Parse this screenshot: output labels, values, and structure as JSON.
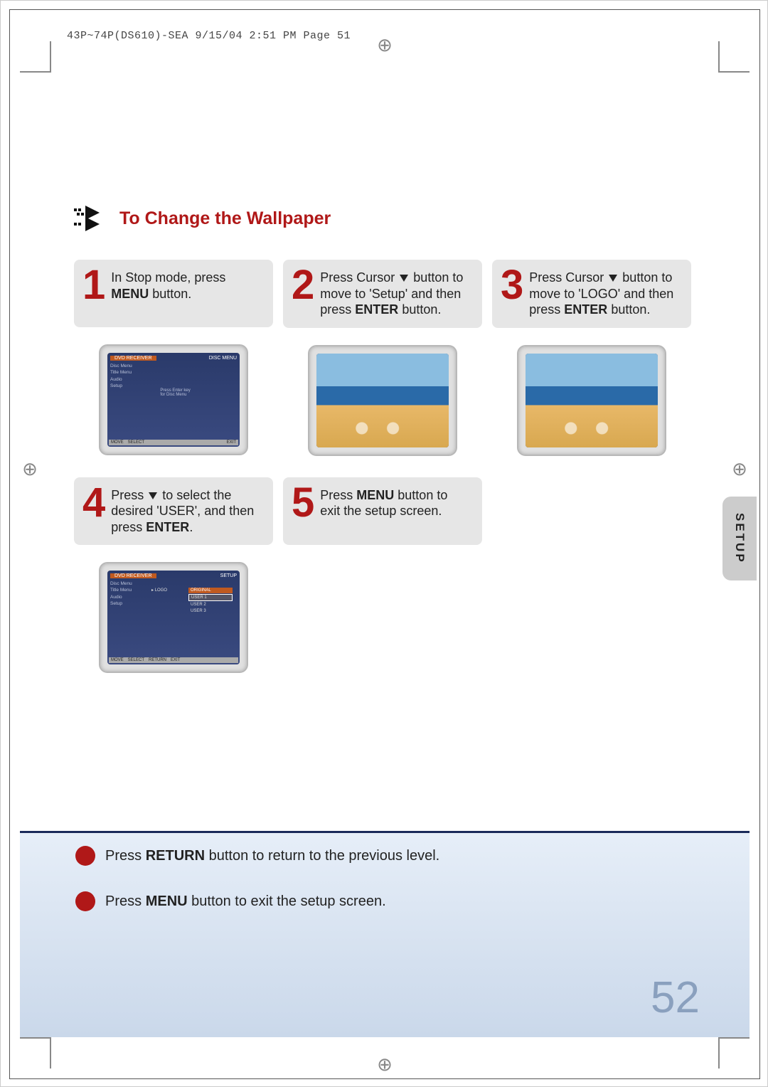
{
  "header": {
    "slug": "43P~74P(DS610)-SEA  9/15/04 2:51 PM  Page 51"
  },
  "section": {
    "title": "To Change the Wallpaper"
  },
  "steps": [
    {
      "num": "1",
      "prefix": "In Stop mode, press ",
      "bold1": "MENU",
      "suffix1": " button."
    },
    {
      "num": "2",
      "prefix": "Press Cursor ",
      "mid1": " button to move to 'Setup' and then press ",
      "bold1": "ENTER",
      "suffix1": " button."
    },
    {
      "num": "3",
      "prefix": "Press Cursor ",
      "mid1": " button to move to 'LOGO' and then press ",
      "bold1": "ENTER",
      "suffix1": " button."
    },
    {
      "num": "4",
      "prefix": "Press ",
      "mid1": " to select the desired 'USER', and then press ",
      "bold1": "ENTER",
      "suffix1": "."
    },
    {
      "num": "5",
      "prefix": "Press ",
      "bold1": "MENU",
      "suffix1": " button to exit the setup screen."
    }
  ],
  "tv1": {
    "tab": "DVD RECEIVER",
    "menu": "DISC MENU",
    "sidebar": [
      "Disc Menu",
      "Title Menu",
      "Audio",
      "Setup"
    ],
    "center1": "Press Enter key",
    "center2": "for Disc Menu",
    "bottom": [
      "MOVE",
      "SELECT",
      "EXIT"
    ]
  },
  "tv4": {
    "tab": "DVD RECEIVER",
    "menu": "SETUP",
    "sidebar": [
      "Disc Menu",
      "Title Menu",
      "Audio",
      "Setup"
    ],
    "logo_label": "LOGO",
    "options": [
      "ORIGINAL",
      "USER 1",
      "USER 2",
      "USER 3"
    ],
    "bottom": [
      "MOVE",
      "SELECT",
      "RETURN",
      "EXIT"
    ]
  },
  "side_tab": "SETUP",
  "tips": {
    "t1a": "Press ",
    "t1b": "RETURN",
    "t1c": " button to return to the previous level.",
    "t2a": "Press ",
    "t2b": "MENU",
    "t2c": " button to exit the setup screen."
  },
  "page_number": "52"
}
